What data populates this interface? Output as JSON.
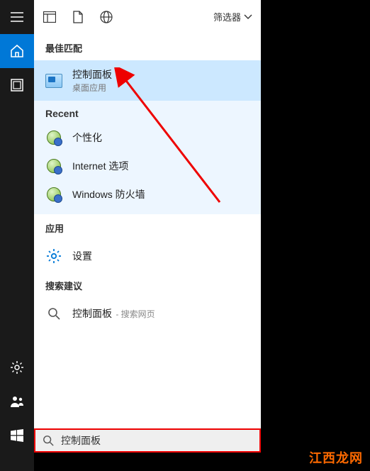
{
  "sidebar": {
    "hamburger": "menu-icon",
    "home": "home-icon",
    "gallery": "gallery-icon",
    "settings": "settings-icon",
    "people": "people-icon",
    "start": "start-icon"
  },
  "header": {
    "filter_label": "筛选器"
  },
  "sections": {
    "best_match": "最佳匹配",
    "recent": "Recent",
    "apps": "应用",
    "suggestions": "搜索建议"
  },
  "best_match": {
    "title": "控制面板",
    "subtitle": "桌面应用"
  },
  "recent": [
    {
      "label": "个性化"
    },
    {
      "label": "Internet 选项"
    },
    {
      "label": "Windows 防火墙"
    }
  ],
  "apps": [
    {
      "label": "设置"
    }
  ],
  "suggestions": [
    {
      "text": "控制面板",
      "hint": " - 搜索网页"
    }
  ],
  "search": {
    "value": "控制面板"
  },
  "watermark": "江西龙网"
}
